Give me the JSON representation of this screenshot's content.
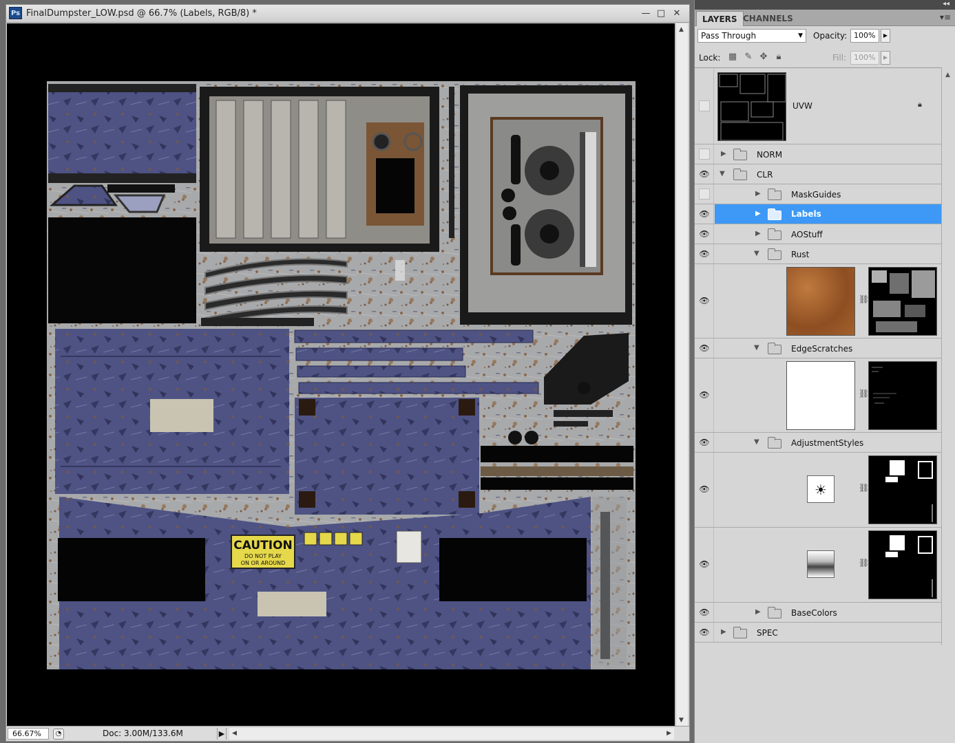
{
  "document": {
    "title": "FinalDumpster_LOW.psd @ 66.7% (Labels, RGB/8) *",
    "app_icon_label": "Ps",
    "zoom": "66.67%",
    "doc_info": "Doc: 3.00M/133.6M",
    "window_buttons": {
      "minimize": "—",
      "restore": "□",
      "close": "✕"
    }
  },
  "texture": {
    "caution_title": "CAUTION",
    "caution_line1": "DO NOT PLAY",
    "caution_line2": "ON OR AROUND"
  },
  "panel": {
    "tabs": [
      "LAYERS",
      "CHANNELS"
    ],
    "active_tab": "LAYERS",
    "blend_mode": "Pass Through",
    "opacity_label": "Opacity:",
    "opacity_value": "100%",
    "lock_label": "Lock:",
    "fill_label": "Fill:",
    "fill_value": "100%",
    "collapse_glyph": "◂◂",
    "menu_glyph": "▾≡"
  },
  "layers": [
    {
      "name": "UVW",
      "type": "layer",
      "visible": false,
      "locked": true
    },
    {
      "name": "NORM",
      "type": "group",
      "visible": false,
      "expanded": false
    },
    {
      "name": "CLR",
      "type": "group",
      "visible": true,
      "expanded": true
    },
    {
      "name": "MaskGuides",
      "type": "group",
      "visible": false,
      "expanded": false
    },
    {
      "name": "Labels",
      "type": "group",
      "visible": true,
      "expanded": false,
      "selected": true
    },
    {
      "name": "AOStuff",
      "type": "group",
      "visible": true,
      "expanded": false
    },
    {
      "name": "Rust",
      "type": "group",
      "visible": true,
      "expanded": true
    },
    {
      "name": "EdgeScratches",
      "type": "group",
      "visible": true,
      "expanded": true
    },
    {
      "name": "AdjustmentStyles",
      "type": "group",
      "visible": true,
      "expanded": true
    },
    {
      "name": "BaseColors",
      "type": "group",
      "visible": true,
      "expanded": false
    },
    {
      "name": "SPEC",
      "type": "group",
      "visible": true,
      "expanded": false
    }
  ],
  "colors": {
    "selection": "#3d99f5",
    "panel_bg": "#d6d6d6",
    "canvas_bg": "#000000",
    "metal_blue": "#4a4f7e",
    "rust": "#8a5a2e",
    "caution_yellow": "#e5d84a"
  }
}
